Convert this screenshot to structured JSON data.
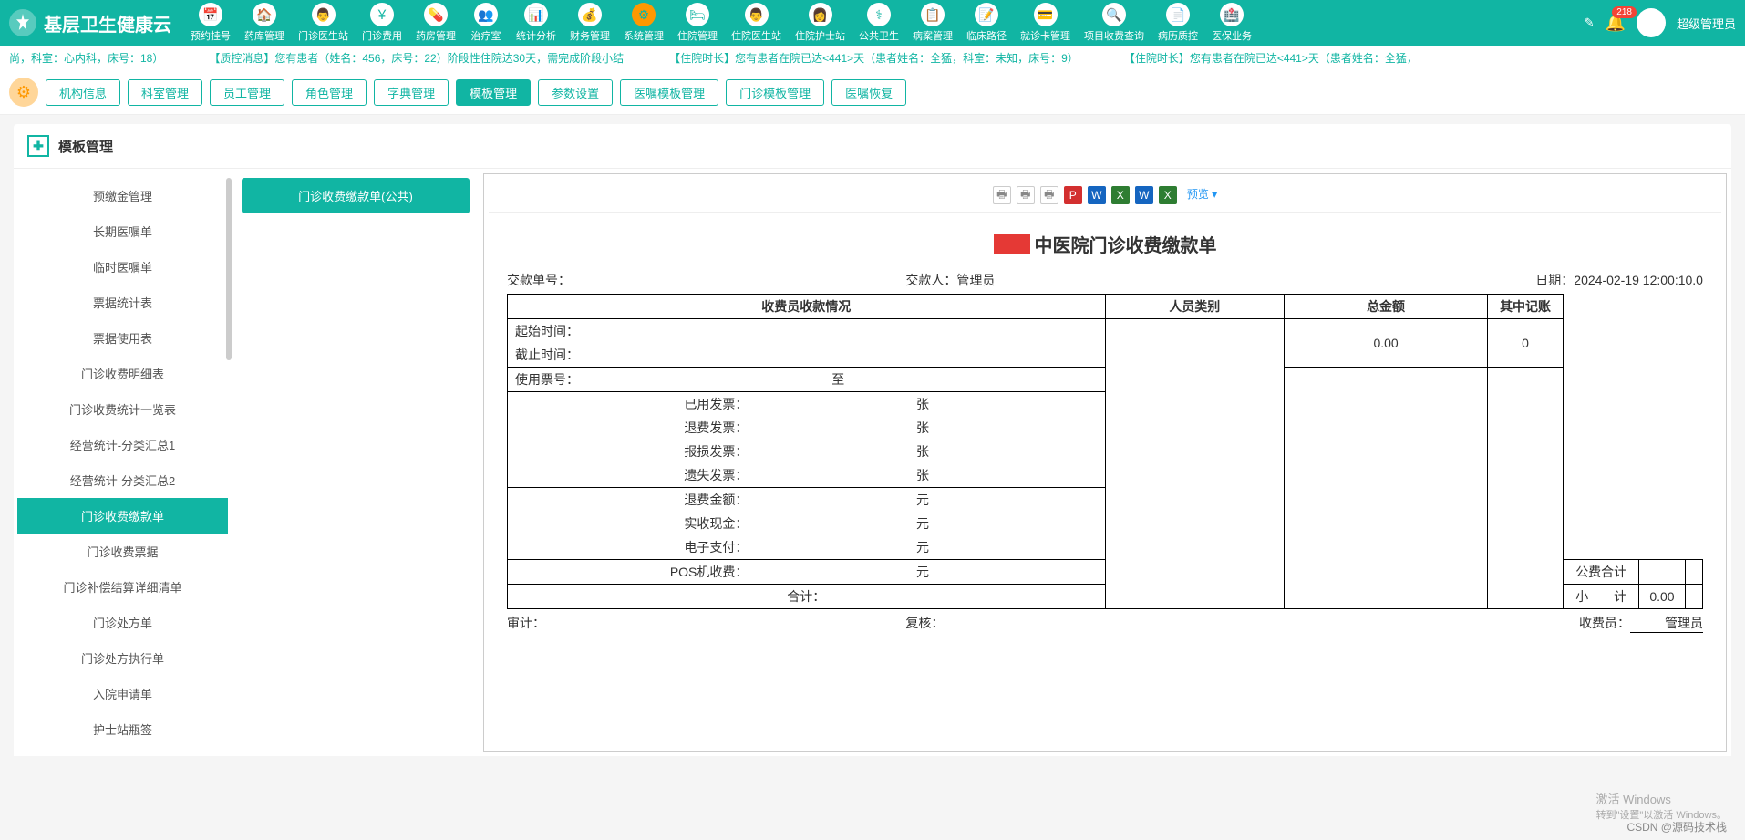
{
  "app": {
    "title": "基层卫生健康云"
  },
  "user": {
    "role": "超级管理员",
    "badge": "218"
  },
  "nav": [
    {
      "label": "预约挂号",
      "ico": "📅"
    },
    {
      "label": "药库管理",
      "ico": "🏠"
    },
    {
      "label": "门诊医生站",
      "ico": "👨"
    },
    {
      "label": "门诊费用",
      "ico": "￥"
    },
    {
      "label": "药房管理",
      "ico": "💊"
    },
    {
      "label": "治疗室",
      "ico": "👥"
    },
    {
      "label": "统计分析",
      "ico": "📊"
    },
    {
      "label": "财务管理",
      "ico": "💰"
    },
    {
      "label": "系统管理",
      "ico": "⚙",
      "active": true
    },
    {
      "label": "住院管理",
      "ico": "🛏"
    },
    {
      "label": "住院医生站",
      "ico": "👨"
    },
    {
      "label": "住院护士站",
      "ico": "👩"
    },
    {
      "label": "公共卫生",
      "ico": "⚕"
    },
    {
      "label": "病案管理",
      "ico": "📋"
    },
    {
      "label": "临床路径",
      "ico": "📝"
    },
    {
      "label": "就诊卡管理",
      "ico": "💳"
    },
    {
      "label": "项目收费查询",
      "ico": "🔍"
    },
    {
      "label": "病历质控",
      "ico": "📄"
    },
    {
      "label": "医保业务",
      "ico": "🏥"
    }
  ],
  "marquee": [
    "尚，科室：心内科，床号：18）",
    "【质控消息】您有患者（姓名：456，床号：22）阶段性住院达30天，需完成阶段小结",
    "【住院时长】您有患者在院已达<441>天（患者姓名：全猛，科室：未知，床号：9）",
    "【住院时长】您有患者在院已达<441>天（患者姓名：全猛，"
  ],
  "subnav": [
    {
      "label": "机构信息"
    },
    {
      "label": "科室管理"
    },
    {
      "label": "员工管理"
    },
    {
      "label": "角色管理"
    },
    {
      "label": "字典管理"
    },
    {
      "label": "模板管理",
      "active": true
    },
    {
      "label": "参数设置"
    },
    {
      "label": "医嘱模板管理"
    },
    {
      "label": "门诊模板管理"
    },
    {
      "label": "医嘱恢复"
    }
  ],
  "page": {
    "title": "模板管理"
  },
  "sidebar": [
    "预缴金管理",
    "长期医嘱单",
    "临时医嘱单",
    "票据统计表",
    "票据使用表",
    "门诊收费明细表",
    "门诊收费统计一览表",
    "经营统计-分类汇总1",
    "经营统计-分类汇总2",
    "门诊收费缴款单",
    "门诊收费票据",
    "门诊补偿结算详细清单",
    "门诊处方单",
    "门诊处方执行单",
    "入院申请单",
    "护士站瓶签"
  ],
  "sidebarActive": 9,
  "template": {
    "name": "门诊收费缴款单(公共)"
  },
  "toolbar": {
    "preview": "预览 ▾"
  },
  "doc": {
    "title": "中医院门诊收费缴款单",
    "idLabel": "交款单号：",
    "id": "",
    "payerLabel": "交款人：",
    "payer": "管理员",
    "dateLabel": "日期：",
    "date": "2024-02-19 12:00:10.0",
    "h1": "收费员收款情况",
    "h2": "人员类别",
    "h3": "总金额",
    "h4": "其中记账",
    "sum": "0.00",
    "credit": "0",
    "rows": {
      "start": "起始时间：",
      "end": "截止时间：",
      "ticket": "使用票号：",
      "to": "至",
      "used": "已用发票：",
      "refund": "退费发票：",
      "damage": "报损发票：",
      "lost": "遗失发票：",
      "unit1": "张",
      "refundAmt": "退费金额：",
      "cash": "实收现金：",
      "epay": "电子支付：",
      "pos": "POS机收费：",
      "unit2": "元",
      "pubSum": "公费合计",
      "totalLbl": "合计：",
      "subLbl": "小　　计",
      "total": "0.00"
    },
    "foot": {
      "audit": "审计：",
      "review": "复核：",
      "cashier": "收费员：",
      "cashierName": "管理员"
    }
  },
  "wm": {
    "l1": "激活 Windows",
    "l2": "转到\"设置\"以激活 Windows。"
  },
  "footer": "CSDN @源码技术栈"
}
